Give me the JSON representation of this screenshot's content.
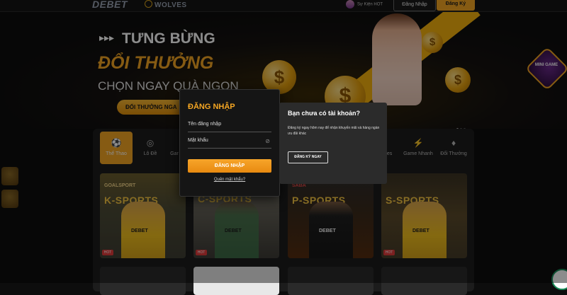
{
  "header": {
    "logo": "DEBET",
    "partner": "WOLVES",
    "user_label": "Sự Kiện HOT",
    "login_label": "Đăng Nhập",
    "register_label": "Đăng Ký"
  },
  "banner": {
    "arrows": "▸▸▸",
    "line1": "TƯNG BỪNG",
    "line2": "ĐỔI THƯỞNG",
    "line3": "CHỌN NGAY QUÀ NGON",
    "cta": "ĐỔI THƯỞNG NGA"
  },
  "mini_game": {
    "label": "MINI GAME"
  },
  "categories": [
    {
      "label": "Thể Thao",
      "icon": "soccer-ball-icon"
    },
    {
      "label": "Lô Đề",
      "icon": "lottery-icon"
    },
    {
      "label": "Gar",
      "icon": "game-icon"
    },
    {
      "label": "Games",
      "icon": "games-icon"
    },
    {
      "label": "Game Nhanh",
      "icon": "lightning-icon"
    },
    {
      "label": "Đổi Thưởng",
      "icon": "money-bag-icon"
    }
  ],
  "cards": [
    {
      "brand": "GOALSPORT",
      "title": "K-SPORTS",
      "badge": "HOT"
    },
    {
      "brand": "",
      "title": "C-SPORTS",
      "badge": "HOT"
    },
    {
      "brand": "SABA",
      "title": "P-SPORTS",
      "badge": ""
    },
    {
      "brand": "",
      "title": "S-SPORTS",
      "badge": "HOT"
    }
  ],
  "card_logo": "DEBET",
  "login": {
    "title": "ĐĂNG NHẬP",
    "username_placeholder": "Tên đăng nhập",
    "password_placeholder": "Mật khẩu",
    "submit": "ĐĂNG NHẬP",
    "forgot": "Quên mật khẩu?"
  },
  "register": {
    "title": "Bạn chưa có tài khoản?",
    "text": "Đăng ký ngay hôm nay để nhận khuyến mãi và hàng ngàn ưu đãi khác",
    "button": "ĐĂNG KÝ NGAY"
  },
  "colors": {
    "accent": "#f5a623",
    "background": "#0d0d0d",
    "modal": "#151515",
    "modal_secondary": "#2b2b2b"
  }
}
